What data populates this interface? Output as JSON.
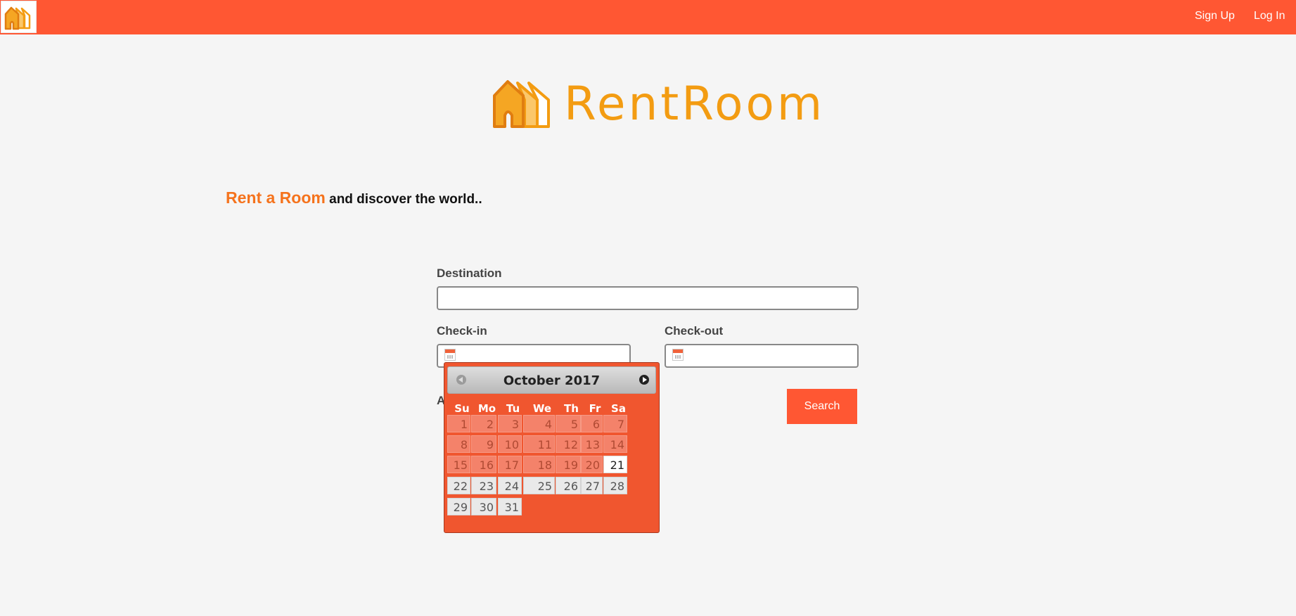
{
  "nav": {
    "signup": "Sign Up",
    "login": "Log In",
    "logo_icon": "house-logo-icon",
    "bg_color": "#ff5733"
  },
  "brand": {
    "name": "RentRoom",
    "color": "#f39c12"
  },
  "tagline": {
    "accent": "Rent a Room",
    "rest": " and discover the world.."
  },
  "form": {
    "destination_label": "Destination",
    "destination_value": "",
    "checkin_label": "Check-in",
    "checkin_value": "",
    "checkout_label": "Check-out",
    "checkout_value": "",
    "partial_label": "A",
    "search_label": "Search",
    "calendar_icon": "calendar-icon"
  },
  "datepicker": {
    "month_title": "October 2017",
    "weekdays": [
      "Su",
      "Mo",
      "Tu",
      "We",
      "Th",
      "Fr",
      "Sa"
    ],
    "days": [
      {
        "d": "1",
        "s": "past"
      },
      {
        "d": "2",
        "s": "past"
      },
      {
        "d": "3",
        "s": "past"
      },
      {
        "d": "4",
        "s": "past"
      },
      {
        "d": "5",
        "s": "past"
      },
      {
        "d": "6",
        "s": "past"
      },
      {
        "d": "7",
        "s": "past"
      },
      {
        "d": "8",
        "s": "past"
      },
      {
        "d": "9",
        "s": "past"
      },
      {
        "d": "10",
        "s": "past"
      },
      {
        "d": "11",
        "s": "past"
      },
      {
        "d": "12",
        "s": "past"
      },
      {
        "d": "13",
        "s": "past"
      },
      {
        "d": "14",
        "s": "past"
      },
      {
        "d": "15",
        "s": "past"
      },
      {
        "d": "16",
        "s": "past"
      },
      {
        "d": "17",
        "s": "past"
      },
      {
        "d": "18",
        "s": "past"
      },
      {
        "d": "19",
        "s": "past"
      },
      {
        "d": "20",
        "s": "past"
      },
      {
        "d": "21",
        "s": "today"
      },
      {
        "d": "22",
        "s": "active"
      },
      {
        "d": "23",
        "s": "active"
      },
      {
        "d": "24",
        "s": "active"
      },
      {
        "d": "25",
        "s": "active"
      },
      {
        "d": "26",
        "s": "active"
      },
      {
        "d": "27",
        "s": "active"
      },
      {
        "d": "28",
        "s": "active"
      },
      {
        "d": "29",
        "s": "active"
      },
      {
        "d": "30",
        "s": "active"
      },
      {
        "d": "31",
        "s": "active"
      }
    ],
    "prev_icon": "chevron-left-icon",
    "next_icon": "chevron-right-icon"
  }
}
